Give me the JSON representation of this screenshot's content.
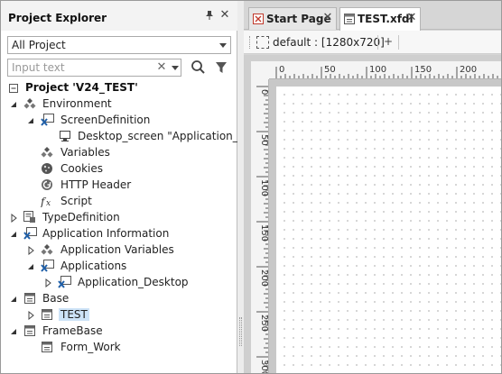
{
  "project_explorer": {
    "title": "Project Explorer",
    "scope_value": "All Project",
    "search_placeholder": "Input text",
    "tree": [
      {
        "label": "Project 'V24_TEST'",
        "icon": "project-icon",
        "bold": true
      },
      {
        "label": "Environment",
        "icon": "environment-icon"
      },
      {
        "label": "ScreenDefinition",
        "icon": "screen-definition-icon"
      },
      {
        "label": "Desktop_screen \"Application_Des",
        "icon": "monitor-icon"
      },
      {
        "label": "Variables",
        "icon": "variables-icon"
      },
      {
        "label": "Cookies",
        "icon": "cookies-icon"
      },
      {
        "label": "HTTP Header",
        "icon": "http-header-icon"
      },
      {
        "label": "Script",
        "icon": "script-icon"
      },
      {
        "label": "TypeDefinition",
        "icon": "type-definition-icon"
      },
      {
        "label": "Application Information",
        "icon": "application-information-icon"
      },
      {
        "label": "Application Variables",
        "icon": "application-variables-icon"
      },
      {
        "label": "Applications",
        "icon": "applications-icon"
      },
      {
        "label": "Application_Desktop",
        "icon": "application-desktop-icon"
      },
      {
        "label": "Base",
        "icon": "base-icon"
      },
      {
        "label": "TEST",
        "icon": "form-icon",
        "selected": true
      },
      {
        "label": "FrameBase",
        "icon": "framebase-icon"
      },
      {
        "label": "Form_Work",
        "icon": "form-icon"
      }
    ]
  },
  "editor": {
    "tabs": [
      {
        "label": "Start Page",
        "icon": "start-page-icon",
        "active": false
      },
      {
        "label": "TEST.xfdl",
        "icon": "form-tab-icon",
        "active": true
      }
    ],
    "toolbar": {
      "screen_label": "default :  [1280x720]",
      "add_label": "+"
    },
    "ruler": {
      "h_labels": [
        "0",
        "50",
        "100",
        "150",
        "200"
      ],
      "v_labels": [
        "0",
        "50",
        "100",
        "150",
        "200",
        "250",
        "300"
      ]
    }
  },
  "colors": {
    "selection": "#cde3f7",
    "accent_blue": "#1f5fa8",
    "close_red": "#c0392b"
  }
}
